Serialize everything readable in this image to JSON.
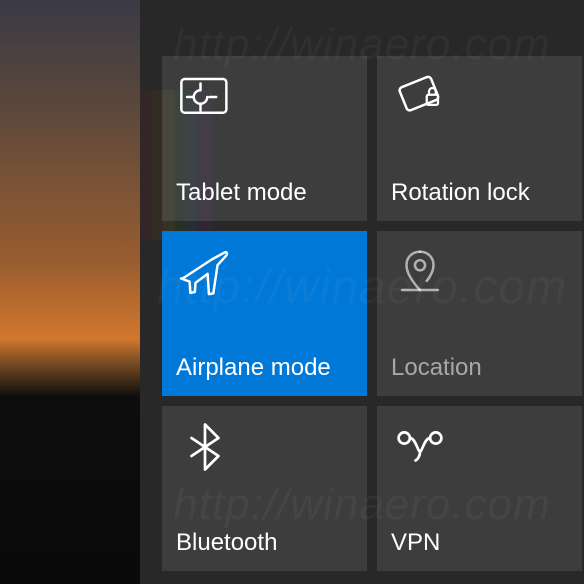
{
  "watermark": {
    "text": "http://winaero.com"
  },
  "actionCenter": {
    "tiles": [
      {
        "label": "Tablet mode",
        "icon": "tablet-mode-icon",
        "active": false,
        "dimmed": false
      },
      {
        "label": "Rotation lock",
        "icon": "rotation-lock-icon",
        "active": false,
        "dimmed": false
      },
      {
        "label": "Airplane mode",
        "icon": "airplane-mode-icon",
        "active": true,
        "dimmed": false
      },
      {
        "label": "Location",
        "icon": "location-icon",
        "active": false,
        "dimmed": true
      },
      {
        "label": "Bluetooth",
        "icon": "bluetooth-icon",
        "active": false,
        "dimmed": false
      },
      {
        "label": "VPN",
        "icon": "vpn-icon",
        "active": false,
        "dimmed": false
      }
    ]
  }
}
